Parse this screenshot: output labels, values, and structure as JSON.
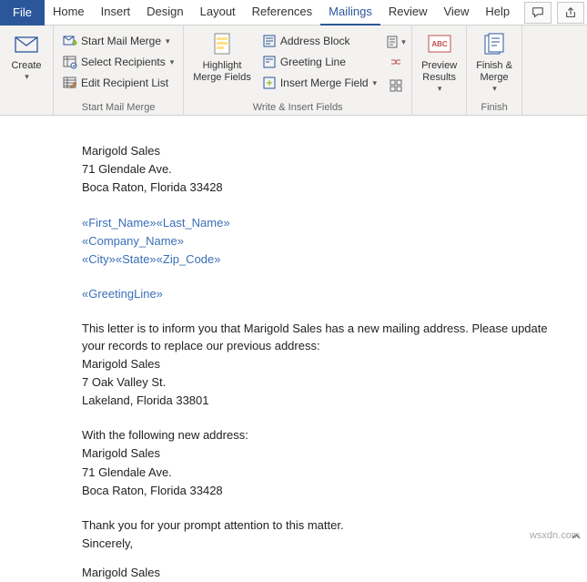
{
  "tabs": {
    "file": "File",
    "home": "Home",
    "insert": "Insert",
    "design": "Design",
    "layout": "Layout",
    "references": "References",
    "mailings": "Mailings",
    "review": "Review",
    "view": "View",
    "help": "Help"
  },
  "ribbon": {
    "create": {
      "label": "Create",
      "group": "Create"
    },
    "startMailMerge": "Start Mail Merge",
    "selectRecipients": "Select Recipients",
    "editRecipientList": "Edit Recipient List",
    "startGroup": "Start Mail Merge",
    "highlightMergeFields": "Highlight\nMerge Fields",
    "addressBlock": "Address Block",
    "greetingLine": "Greeting Line",
    "insertMergeField": "Insert Merge Field",
    "writeGroup": "Write & Insert Fields",
    "previewResults": "Preview\nResults",
    "previewGroup": "Preview Results",
    "finishMerge": "Finish &\nMerge",
    "finishGroup": "Finish"
  },
  "doc": {
    "sender": {
      "name": "Marigold Sales",
      "street": "71 Glendale Ave.",
      "cityline": "Boca Raton, Florida 33428"
    },
    "fields": {
      "line1": "«First_Name»«Last_Name»",
      "line2": "«Company_Name»",
      "line3": "«City»«State»«Zip_Code»",
      "greeting": "«GreetingLine»"
    },
    "body1": "This letter is to inform you that Marigold Sales has a new mailing address. Please update your records to replace our previous address:",
    "oldAddr": {
      "name": "Marigold Sales",
      "street": "7 Oak Valley St.",
      "cityline": "Lakeland, Florida 33801"
    },
    "withFollowing": "With the following new address:",
    "newAddr": {
      "name": "Marigold Sales",
      "street": "71 Glendale Ave.",
      "cityline": "Boca Raton, Florida 33428"
    },
    "thankyou": "Thank you for your prompt attention to this matter.",
    "sincerely": "Sincerely,",
    "signature": "Marigold Sales"
  },
  "watermark": "wsxdn.com"
}
